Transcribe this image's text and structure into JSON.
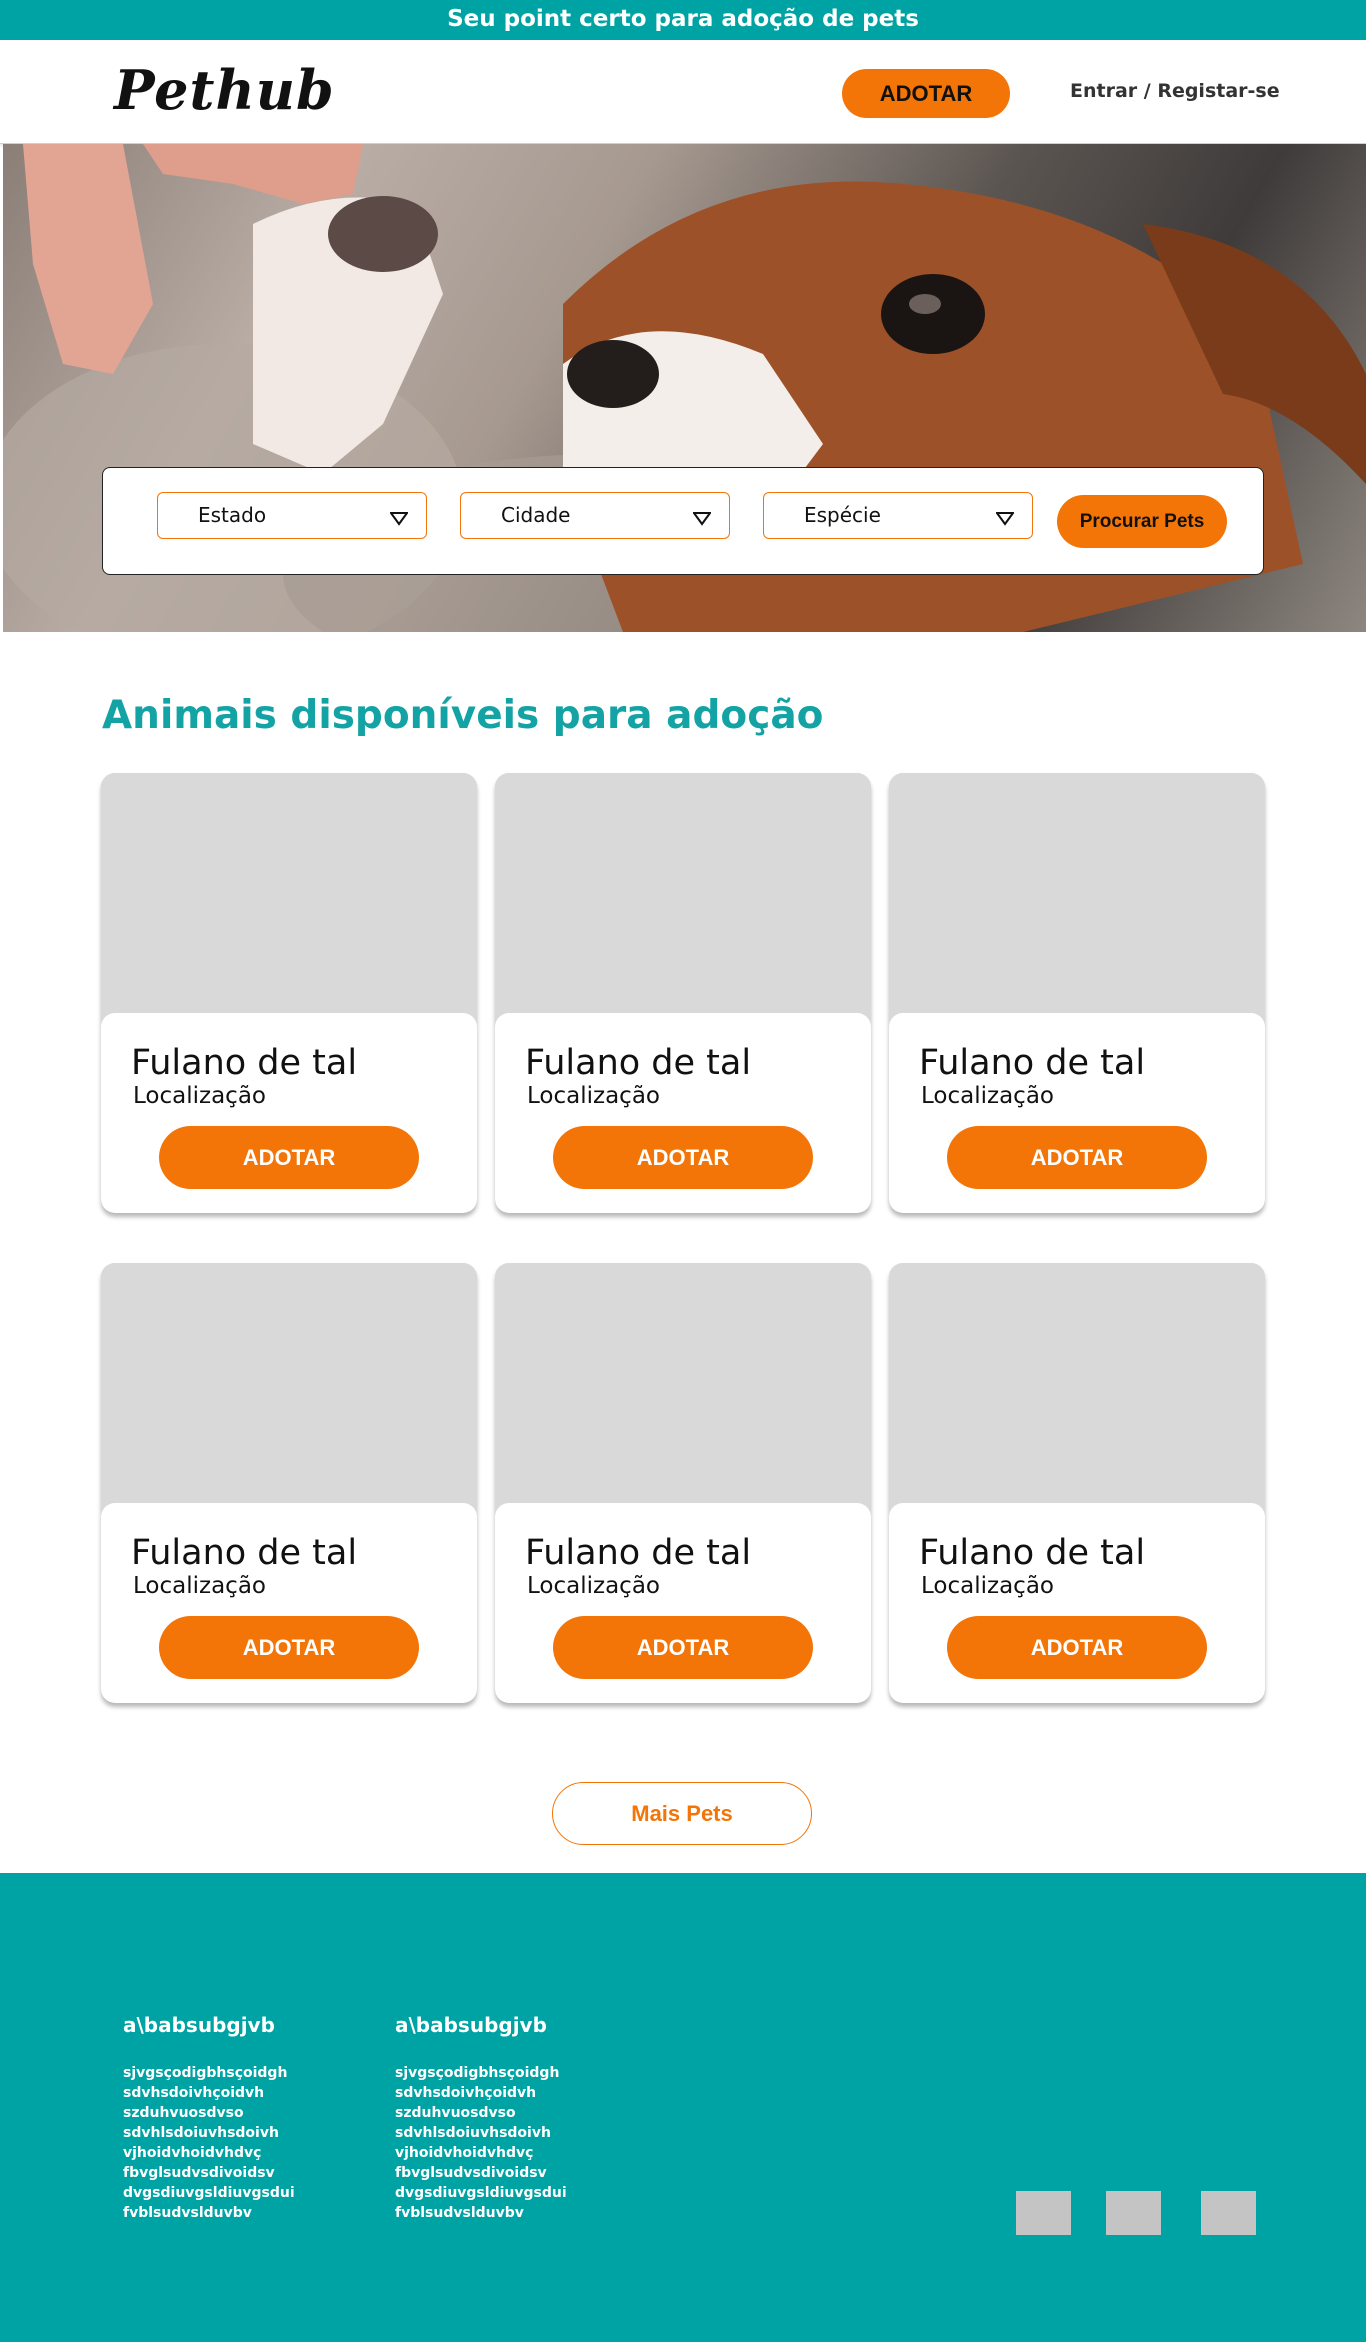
{
  "topbar": {
    "text": "Seu point certo para adoção de pets"
  },
  "header": {
    "logo": "Pethub",
    "adotar_label": "ADOTAR",
    "login_label": "Entrar / Registar-se"
  },
  "search": {
    "state_label": "Estado",
    "city_label": "Cidade",
    "species_label": "Espécie",
    "submit_label": "Procurar Pets"
  },
  "section": {
    "title": "Animais disponíveis para adoção"
  },
  "pets": [
    {
      "name": "Fulano de tal",
      "location": "Localização",
      "button": "ADOTAR"
    },
    {
      "name": "Fulano de tal",
      "location": "Localização",
      "button": "ADOTAR"
    },
    {
      "name": "Fulano de tal",
      "location": "Localização",
      "button": "ADOTAR"
    },
    {
      "name": "Fulano de tal",
      "location": "Localização",
      "button": "ADOTAR"
    },
    {
      "name": "Fulano de tal",
      "location": "Localização",
      "button": "ADOTAR"
    },
    {
      "name": "Fulano de tal",
      "location": "Localização",
      "button": "ADOTAR"
    }
  ],
  "more_button": "Mais Pets",
  "footer": {
    "columns": [
      {
        "heading": "a\\babsubgjvb",
        "links": [
          "sjvgsçodigbhsçoidgh",
          "sdvhsdoivhçoidvh",
          "szduhvuosdvso",
          "sdvhlsdoiuvhsdoivh",
          "vjhoidvhoidvhdvç",
          "fbvglsudvsdivoidsv",
          "dvgsdiuvgsldiuvgsdui",
          "fvblsudvslduvbv"
        ]
      },
      {
        "heading": "a\\babsubgjvb",
        "links": [
          "sjvgsçodigbhsçoidgh",
          "sdvhsdoivhçoidvh",
          "szduhvuosdvso",
          "sdvhlsdoiuvhsdoivh",
          "vjhoidvhoidvhdvç",
          "fbvglsudvsdivoidsv",
          "dvgsdiuvgsldiuvgsdui",
          "fvblsudvslduvbv"
        ]
      }
    ]
  },
  "colors": {
    "teal": "#00a3a4",
    "orange": "#f37507",
    "placeholder": "#d9d9d9"
  }
}
